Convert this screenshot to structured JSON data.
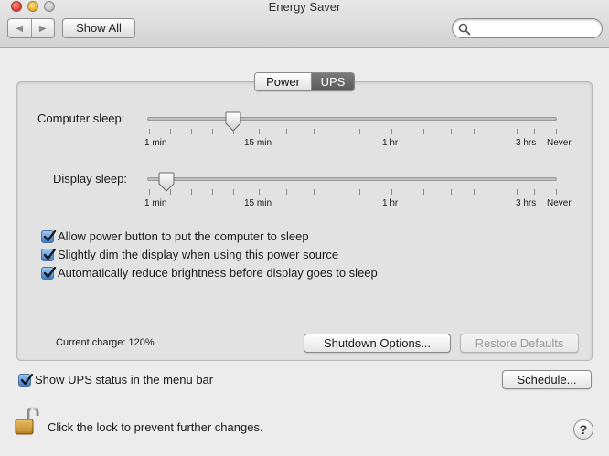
{
  "window": {
    "title": "Energy Saver",
    "nav_back_icon": "back-arrow-icon",
    "nav_forward_icon": "forward-arrow-icon",
    "show_all_label": "Show All",
    "search": {
      "placeholder": "",
      "value": ""
    }
  },
  "tabs": [
    {
      "label": "Power",
      "selected": false
    },
    {
      "label": "UPS",
      "selected": true
    }
  ],
  "sliders": {
    "computer_sleep": {
      "label": "Computer sleep:",
      "tick_labels": {
        "min1": "1 min",
        "min15": "15 min",
        "hr1": "1 hr",
        "hrs3": "3 hrs",
        "never": "Never"
      },
      "value": "15 min"
    },
    "display_sleep": {
      "label": "Display sleep:",
      "tick_labels": {
        "min1": "1 min",
        "min15": "15 min",
        "hr1": "1 hr",
        "hrs3": "3 hrs",
        "never": "Never"
      },
      "value": "2 min"
    }
  },
  "options": [
    {
      "label": "Allow power button to put the computer to sleep",
      "checked": true
    },
    {
      "label": "Slightly dim the display when using this power source",
      "checked": true
    },
    {
      "label": "Automatically reduce brightness before display goes to sleep",
      "checked": true
    }
  ],
  "status": {
    "current_charge": "Current charge: 120%"
  },
  "buttons": {
    "shutdown_options": "Shutdown Options...",
    "restore_defaults": "Restore Defaults",
    "schedule": "Schedule..."
  },
  "menu_bar_option": {
    "label": "Show UPS status in the menu bar",
    "checked": true
  },
  "lock": {
    "label": "Click the lock to prevent further changes.",
    "icon": "unlocked-padlock-icon"
  },
  "help": {
    "label": "?"
  },
  "colors": {
    "accent": "#3f7dcb",
    "selected_tab": "#6a6a6a"
  }
}
